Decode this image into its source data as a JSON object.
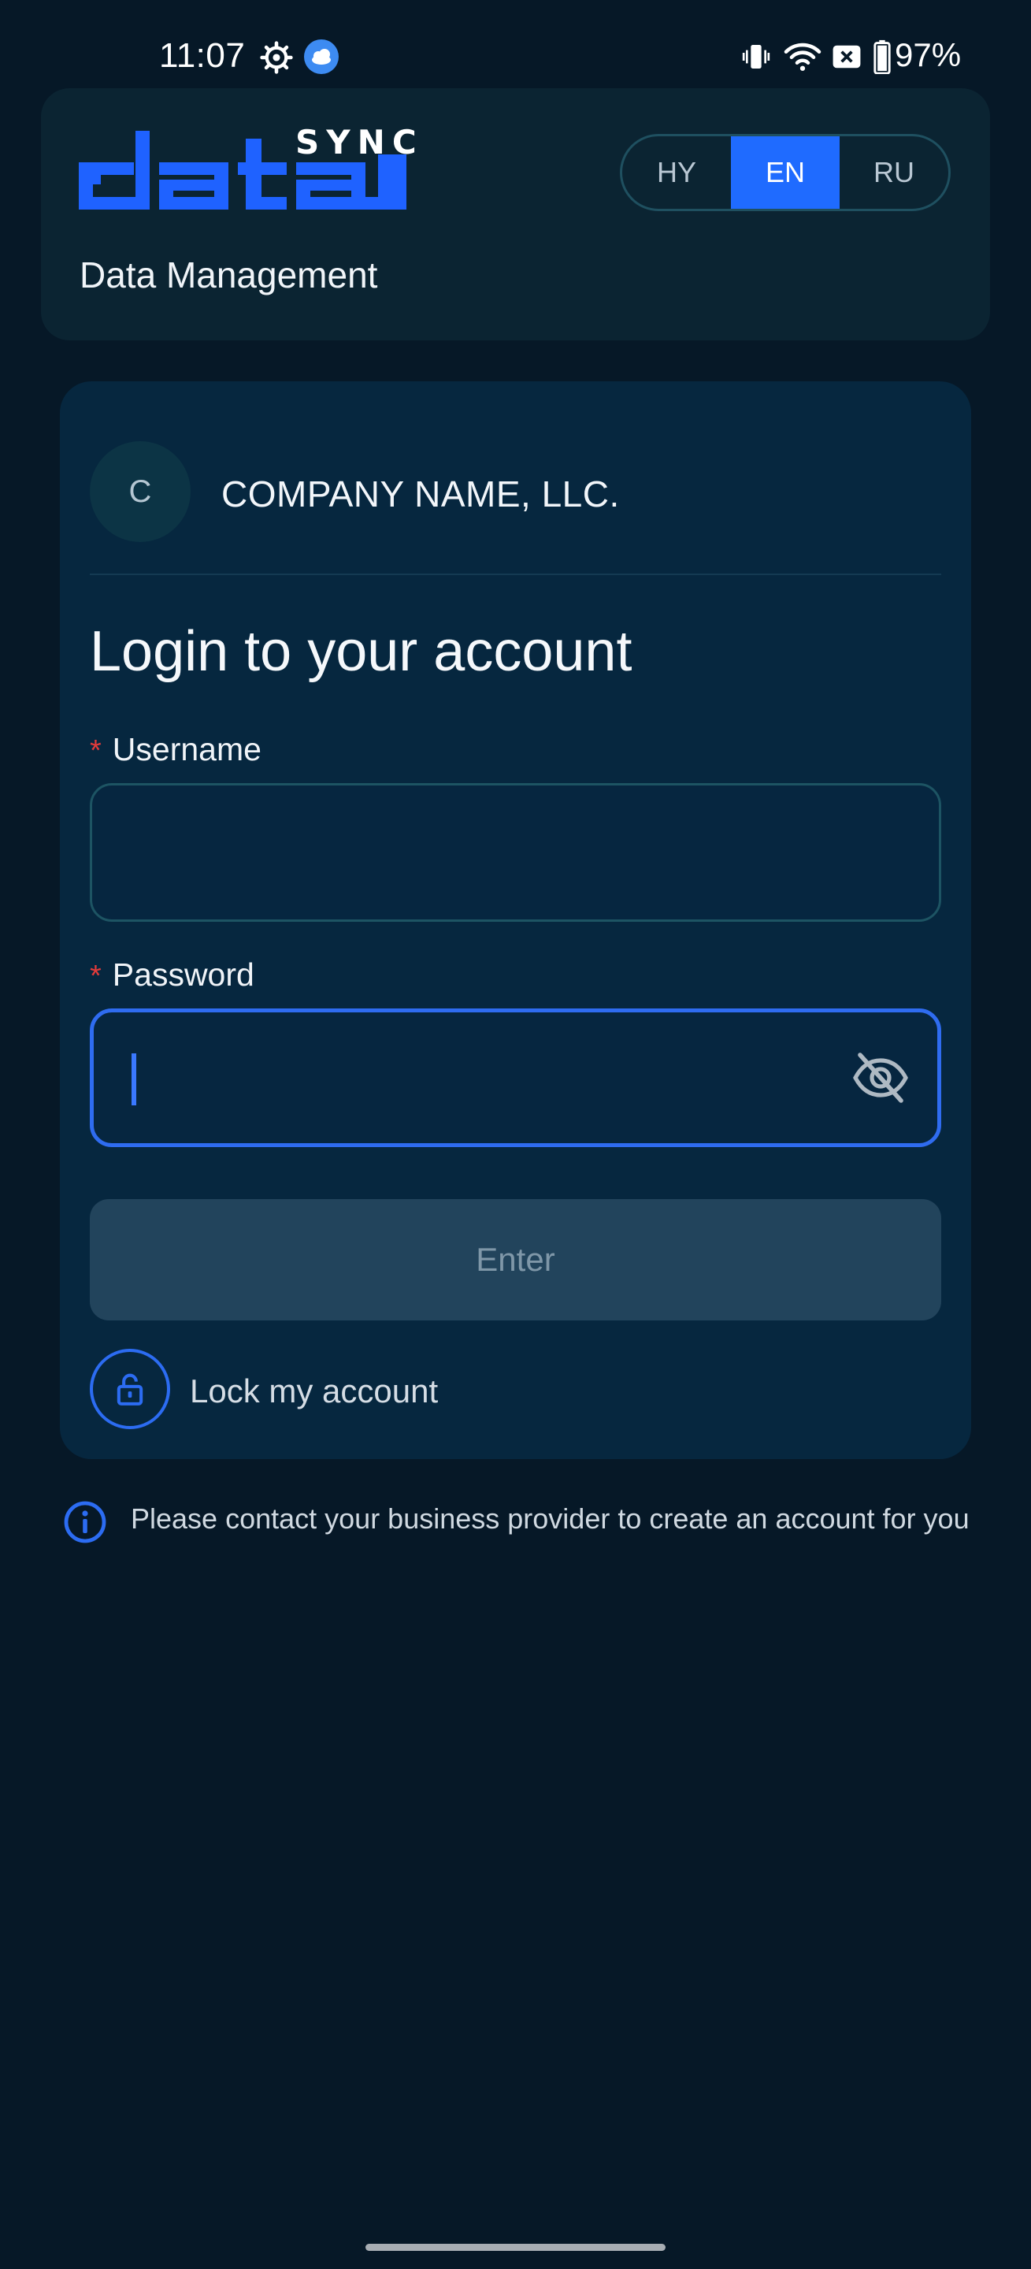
{
  "status_bar": {
    "time": "11:07",
    "battery": "97%",
    "icons": [
      "gear-icon",
      "weather-icon",
      "vibrate-icon",
      "wifi-icon",
      "no-sim-icon",
      "battery-icon"
    ]
  },
  "header": {
    "logo_word": "data",
    "logo_sync": "SYNC",
    "subtitle": "Data Management",
    "languages": [
      "HY",
      "EN",
      "RU"
    ],
    "selected_language": "EN"
  },
  "company": {
    "initial": "C",
    "name": "COMPANY NAME, LLC."
  },
  "login": {
    "title": "Login to your account",
    "required_mark": "*",
    "username_label": "Username",
    "username_value": "",
    "password_label": "Password",
    "password_value": "",
    "enter_label": "Enter",
    "lock_label": "Lock my account"
  },
  "info": {
    "text": "Please contact your business provider to create an account for you"
  },
  "colors": {
    "background": "#061827",
    "card": "#06273f",
    "header_card": "#0b2432",
    "accent": "#1f6bff",
    "required": "#e23b3b",
    "disabled_button": "#22445c"
  }
}
